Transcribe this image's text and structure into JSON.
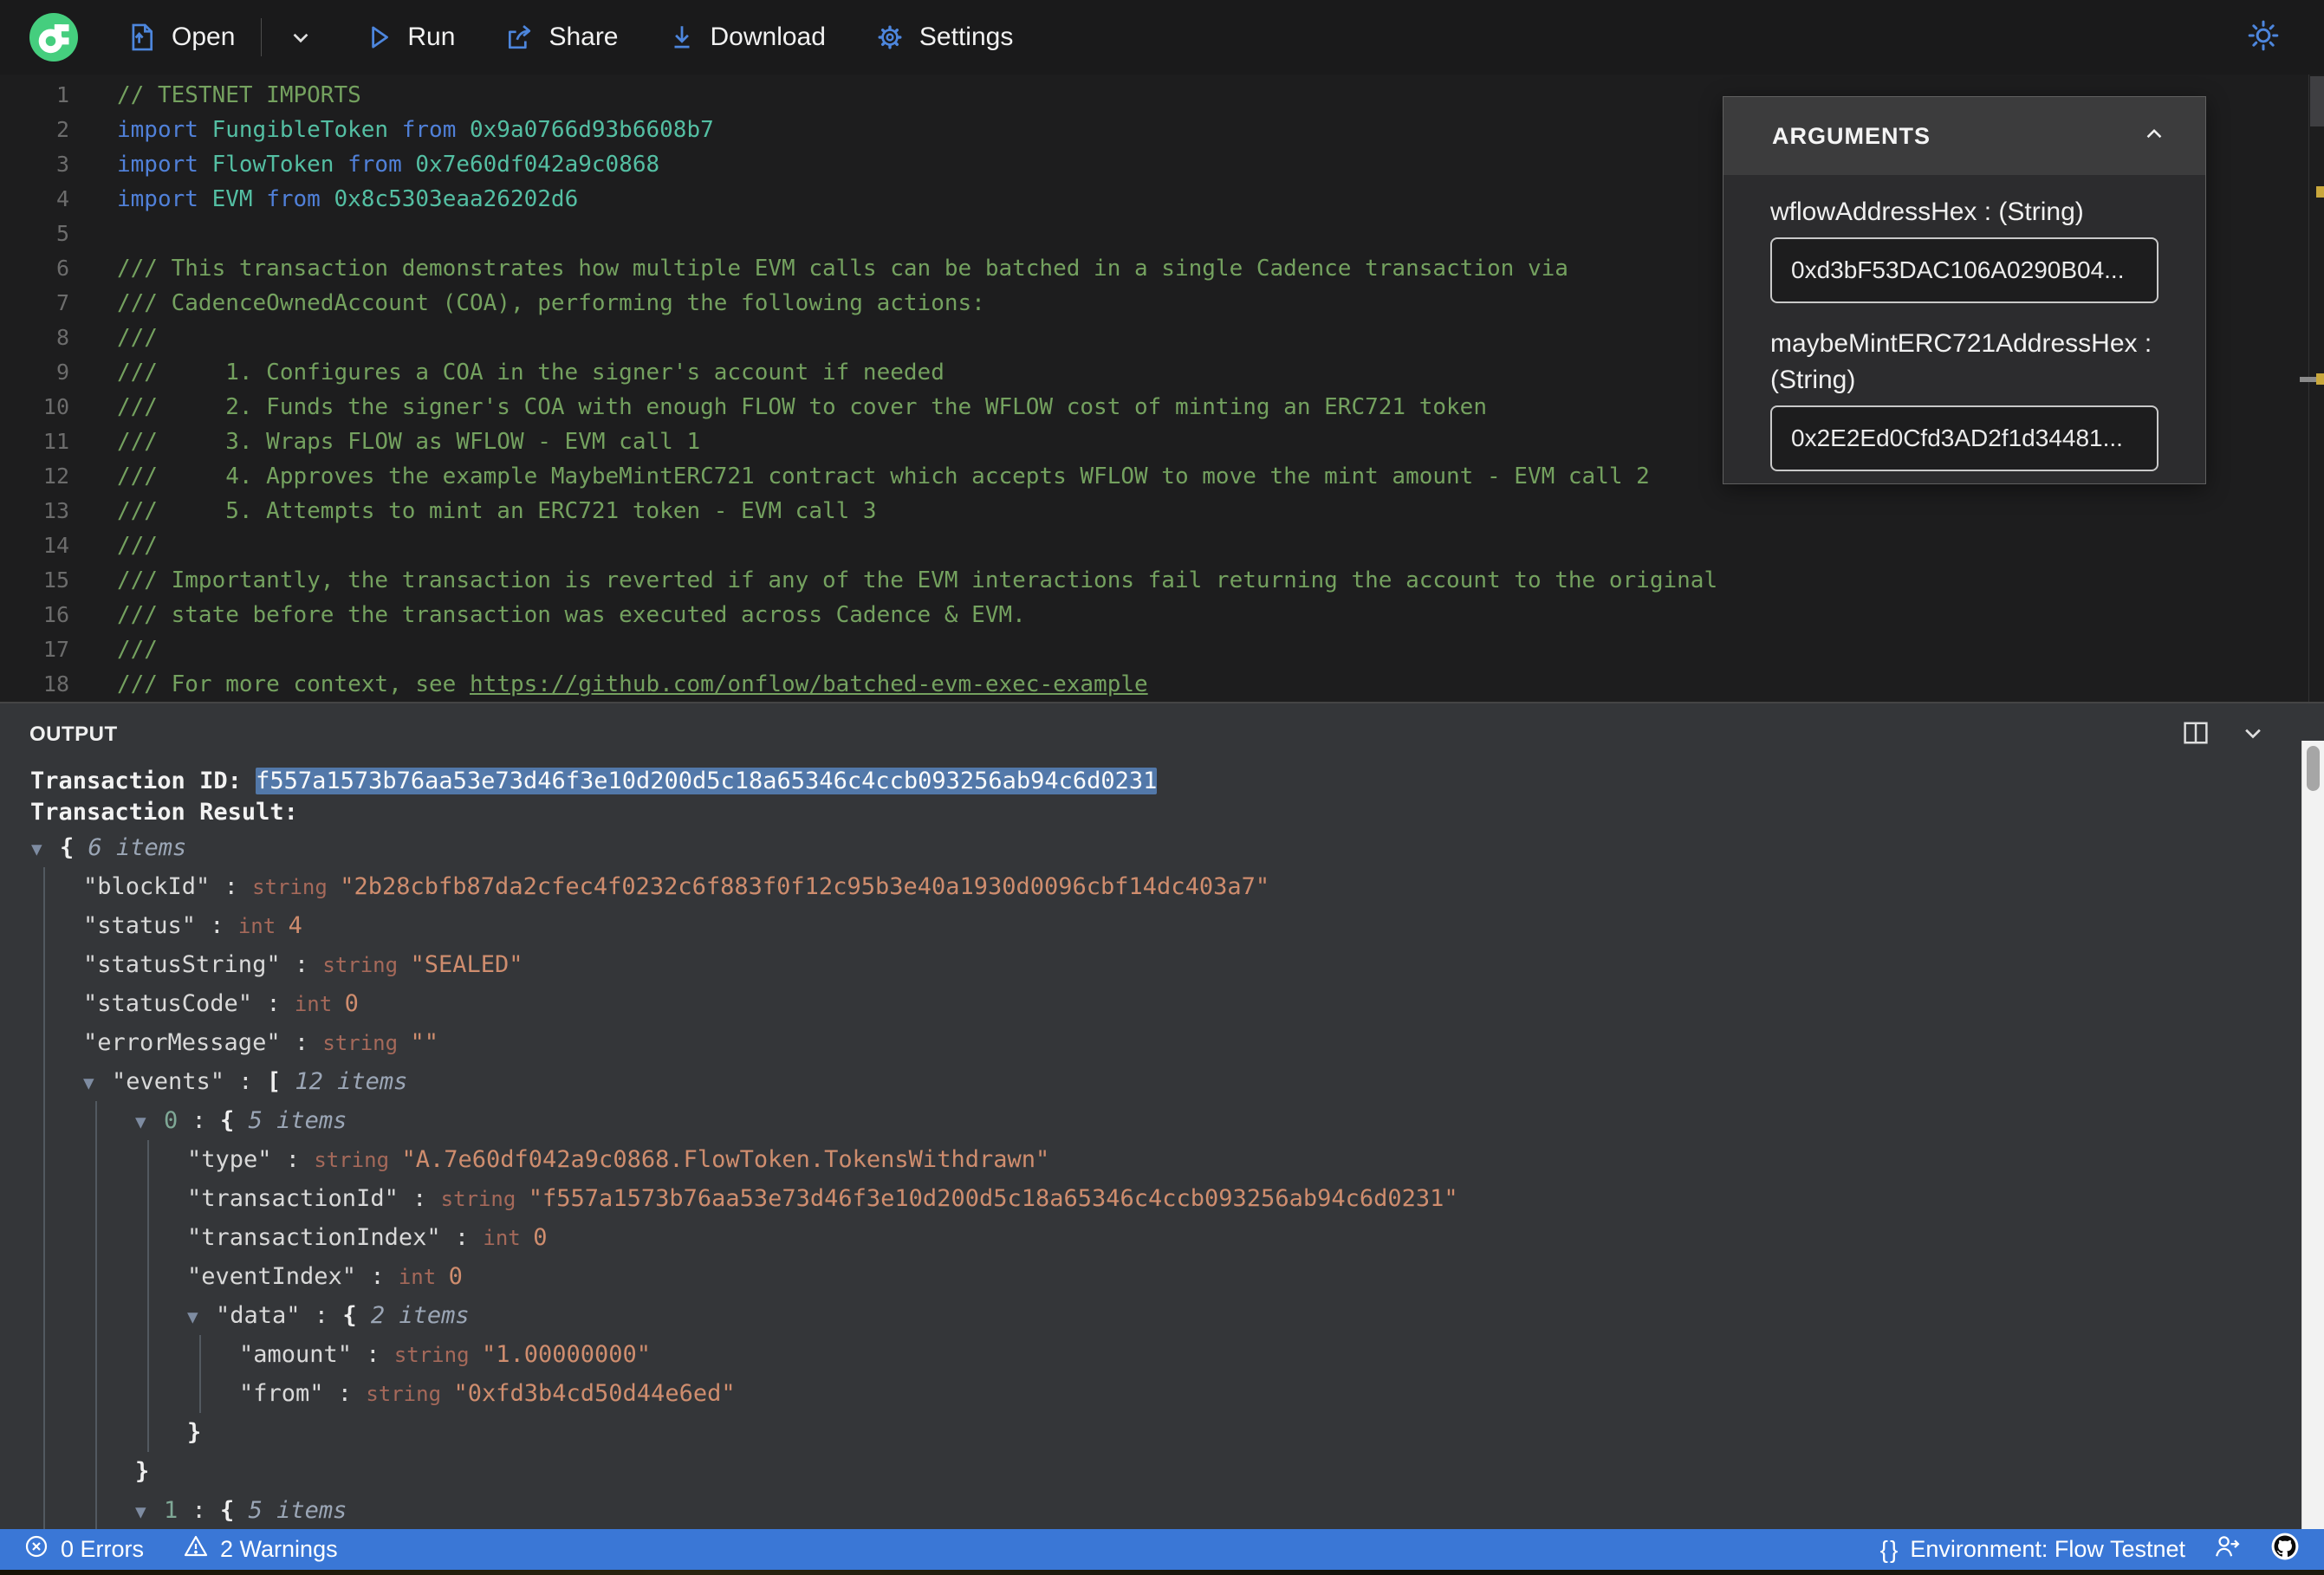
{
  "toolbar": {
    "open_label": "Open",
    "run_label": "Run",
    "share_label": "Share",
    "download_label": "Download",
    "settings_label": "Settings"
  },
  "editor": {
    "lines": [
      {
        "n": "1",
        "tokens": [
          [
            "com",
            "// TESTNET IMPORTS"
          ]
        ]
      },
      {
        "n": "2",
        "tokens": [
          [
            "kw",
            "import "
          ],
          [
            "ty",
            "FungibleToken"
          ],
          [
            "kw",
            " from "
          ],
          [
            "ty",
            "0x9a0766d93b6608b7"
          ]
        ]
      },
      {
        "n": "3",
        "tokens": [
          [
            "kw",
            "import "
          ],
          [
            "ty",
            "FlowToken"
          ],
          [
            "kw",
            " from "
          ],
          [
            "ty",
            "0x7e60df042a9c0868"
          ]
        ]
      },
      {
        "n": "4",
        "tokens": [
          [
            "kw",
            "import "
          ],
          [
            "ty",
            "EVM"
          ],
          [
            "kw",
            " from "
          ],
          [
            "ty",
            "0x8c5303eaa26202d6"
          ]
        ]
      },
      {
        "n": "5",
        "tokens": []
      },
      {
        "n": "6",
        "tokens": [
          [
            "com",
            "/// This transaction demonstrates how multiple EVM calls can be batched in a single Cadence transaction via"
          ]
        ]
      },
      {
        "n": "7",
        "tokens": [
          [
            "com",
            "/// CadenceOwnedAccount (COA), performing the following actions:"
          ]
        ]
      },
      {
        "n": "8",
        "tokens": [
          [
            "com",
            "///"
          ]
        ]
      },
      {
        "n": "9",
        "tokens": [
          [
            "com",
            "///     1. Configures a COA in the signer's account if needed"
          ]
        ]
      },
      {
        "n": "10",
        "tokens": [
          [
            "com",
            "///     2. Funds the signer's COA with enough FLOW to cover the WFLOW cost of minting an ERC721 token"
          ]
        ]
      },
      {
        "n": "11",
        "tokens": [
          [
            "com",
            "///     3. Wraps FLOW as WFLOW - EVM call 1"
          ]
        ]
      },
      {
        "n": "12",
        "tokens": [
          [
            "com",
            "///     4. Approves the example MaybeMintERC721 contract which accepts WFLOW to move the mint amount - EVM call 2"
          ]
        ]
      },
      {
        "n": "13",
        "tokens": [
          [
            "com",
            "///     5. Attempts to mint an ERC721 token - EVM call 3"
          ]
        ]
      },
      {
        "n": "14",
        "tokens": [
          [
            "com",
            "///"
          ]
        ]
      },
      {
        "n": "15",
        "tokens": [
          [
            "com",
            "/// Importantly, the transaction is reverted if any of the EVM interactions fail returning the account to the original"
          ]
        ]
      },
      {
        "n": "16",
        "tokens": [
          [
            "com",
            "/// state before the transaction was executed across Cadence & EVM."
          ]
        ]
      },
      {
        "n": "17",
        "tokens": [
          [
            "com",
            "///"
          ]
        ]
      },
      {
        "n": "18",
        "tokens": [
          [
            "com",
            "/// For more context, see "
          ],
          [
            "link",
            "https://github.com/onflow/batched-evm-exec-example"
          ]
        ]
      }
    ]
  },
  "arguments_panel": {
    "title": "ARGUMENTS",
    "args": [
      {
        "label": "wflowAddressHex : (String)",
        "value": "0xd3bF53DAC106A0290B04..."
      },
      {
        "label": "maybeMintERC721AddressHex : (String)",
        "value": "0x2E2Ed0Cfd3AD2f1d34481..."
      }
    ]
  },
  "output": {
    "title": "OUTPUT",
    "tx_id_label": "Transaction ID: ",
    "tx_id": "f557a1573b76aa53e73d46f3e10d200d5c18a65346c4ccb093256ab94c6d0231",
    "tx_result_label": "Transaction Result:",
    "rows": [
      {
        "level": 0,
        "tokens": [
          [
            "tri",
            "▼"
          ],
          [
            "brace",
            "{"
          ],
          [
            "count",
            " 6 items"
          ]
        ]
      },
      {
        "level": 1,
        "tokens": [
          [
            "key",
            "\"blockId\""
          ],
          [
            "punc",
            " : "
          ],
          [
            "type",
            "string "
          ],
          [
            "val",
            "\"2b28cbfb87da2cfec4f0232c6f883f0f12c95b3e40a1930d0096cbf14dc403a7\""
          ]
        ]
      },
      {
        "level": 1,
        "tokens": [
          [
            "key",
            "\"status\""
          ],
          [
            "punc",
            " : "
          ],
          [
            "type",
            "int "
          ],
          [
            "val",
            "4"
          ]
        ]
      },
      {
        "level": 1,
        "tokens": [
          [
            "key",
            "\"statusString\""
          ],
          [
            "punc",
            " : "
          ],
          [
            "type",
            "string "
          ],
          [
            "val",
            "\"SEALED\""
          ]
        ]
      },
      {
        "level": 1,
        "tokens": [
          [
            "key",
            "\"statusCode\""
          ],
          [
            "punc",
            " : "
          ],
          [
            "type",
            "int "
          ],
          [
            "val",
            "0"
          ]
        ]
      },
      {
        "level": 1,
        "tokens": [
          [
            "key",
            "\"errorMessage\""
          ],
          [
            "punc",
            " : "
          ],
          [
            "type",
            "string "
          ],
          [
            "val",
            "\"\""
          ]
        ]
      },
      {
        "level": 1,
        "tokens": [
          [
            "tri",
            "▼"
          ],
          [
            "key",
            "\"events\""
          ],
          [
            "punc",
            " : "
          ],
          [
            "brace",
            "["
          ],
          [
            "count",
            " 12 items"
          ]
        ]
      },
      {
        "level": 2,
        "tokens": [
          [
            "tri",
            "▼"
          ],
          [
            "idx",
            "0"
          ],
          [
            "punc",
            " : "
          ],
          [
            "brace",
            "{"
          ],
          [
            "count",
            " 5 items"
          ]
        ]
      },
      {
        "level": 3,
        "tokens": [
          [
            "key",
            "\"type\""
          ],
          [
            "punc",
            " : "
          ],
          [
            "type",
            "string "
          ],
          [
            "val",
            "\"A.7e60df042a9c0868.FlowToken.TokensWithdrawn\""
          ]
        ]
      },
      {
        "level": 3,
        "tokens": [
          [
            "key",
            "\"transactionId\""
          ],
          [
            "punc",
            " : "
          ],
          [
            "type",
            "string "
          ],
          [
            "val",
            "\"f557a1573b76aa53e73d46f3e10d200d5c18a65346c4ccb093256ab94c6d0231\""
          ]
        ]
      },
      {
        "level": 3,
        "tokens": [
          [
            "key",
            "\"transactionIndex\""
          ],
          [
            "punc",
            " : "
          ],
          [
            "type",
            "int "
          ],
          [
            "val",
            "0"
          ]
        ]
      },
      {
        "level": 3,
        "tokens": [
          [
            "key",
            "\"eventIndex\""
          ],
          [
            "punc",
            " : "
          ],
          [
            "type",
            "int "
          ],
          [
            "val",
            "0"
          ]
        ]
      },
      {
        "level": 3,
        "tokens": [
          [
            "tri",
            "▼"
          ],
          [
            "key",
            "\"data\""
          ],
          [
            "punc",
            " : "
          ],
          [
            "brace",
            "{"
          ],
          [
            "count",
            " 2 items"
          ]
        ]
      },
      {
        "level": 4,
        "tokens": [
          [
            "key",
            "\"amount\""
          ],
          [
            "punc",
            " : "
          ],
          [
            "type",
            "string "
          ],
          [
            "val",
            "\"1.00000000\""
          ]
        ]
      },
      {
        "level": 4,
        "tokens": [
          [
            "key",
            "\"from\""
          ],
          [
            "punc",
            " : "
          ],
          [
            "type",
            "string "
          ],
          [
            "val",
            "\"0xfd3b4cd50d44e6ed\""
          ]
        ]
      },
      {
        "level": 3,
        "tokens": [
          [
            "brace",
            "}"
          ]
        ]
      },
      {
        "level": 2,
        "tokens": [
          [
            "brace",
            "}"
          ]
        ]
      },
      {
        "level": 2,
        "tokens": [
          [
            "tri",
            "▼"
          ],
          [
            "idx",
            "1"
          ],
          [
            "punc",
            " : "
          ],
          [
            "brace",
            "{"
          ],
          [
            "count",
            " 5 items"
          ]
        ]
      }
    ]
  },
  "status_bar": {
    "errors": "0 Errors",
    "warnings": "2 Warnings",
    "braces_glyph": "{}",
    "environment": "Environment: Flow Testnet"
  },
  "colors": {
    "accent_blue": "#4d86dd",
    "flow_green": "#45ce7e",
    "status_bar_blue": "#3a77d6",
    "selection_blue": "#5278a9",
    "warning_marker_yellow": "#c9a73c",
    "comment_green": "#74a15f",
    "keyword_blue": "#5080d8",
    "identifier_teal": "#54bfa3",
    "json_value_orange": "#cf8d6e"
  }
}
